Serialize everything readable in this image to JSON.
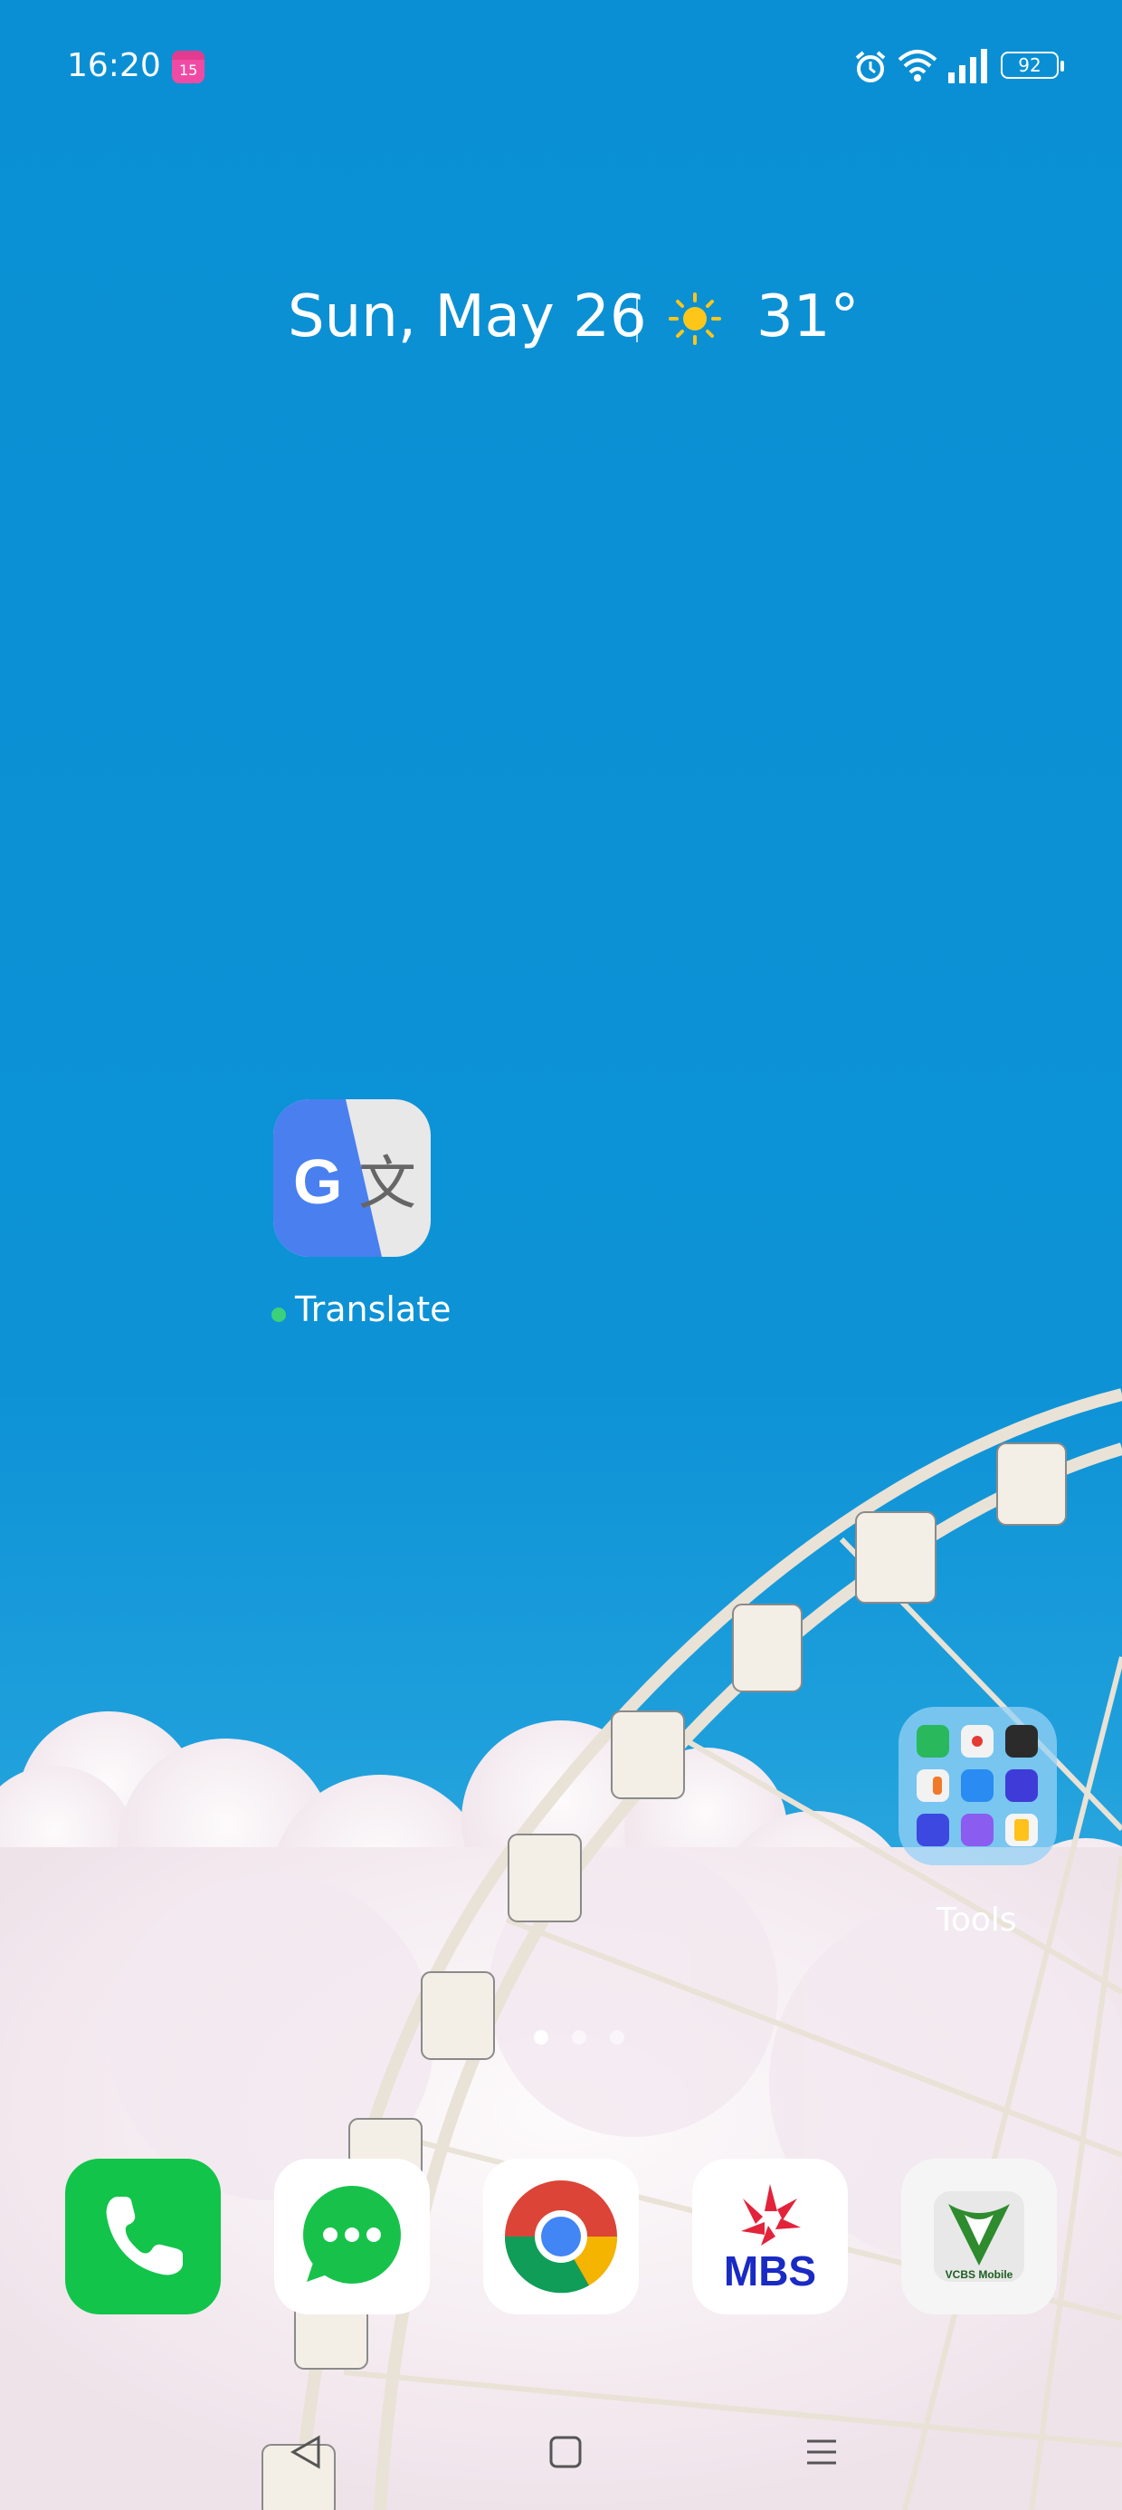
{
  "status_bar": {
    "time": "16:20",
    "battery": "92",
    "calendar_badge": "15"
  },
  "date_widget": {
    "date": "Sun, May 26",
    "temperature": "31°",
    "weather_icon": "sunny-icon"
  },
  "apps": {
    "translate": {
      "label": "Translate",
      "icon": "google-translate-icon"
    }
  },
  "folder": {
    "label": "Tools"
  },
  "pager": {
    "pages": 3,
    "current": 1
  },
  "dock": [
    {
      "name": "phone",
      "icon": "phone-icon"
    },
    {
      "name": "messages",
      "icon": "messages-icon"
    },
    {
      "name": "chrome",
      "icon": "chrome-icon"
    },
    {
      "name": "mbs",
      "icon": "mbs-icon",
      "label": "MBS"
    },
    {
      "name": "vcbs",
      "icon": "vcbs-mobile-icon",
      "label": "VCBS Mobile"
    }
  ],
  "navbar": [
    "back-icon",
    "home-icon",
    "menu-icon"
  ],
  "colors": {
    "sky": "#0A8FD4",
    "phone_green": "#12C44A",
    "mbs_blue": "#1A2AC4",
    "mbs_red": "#E2233A"
  }
}
